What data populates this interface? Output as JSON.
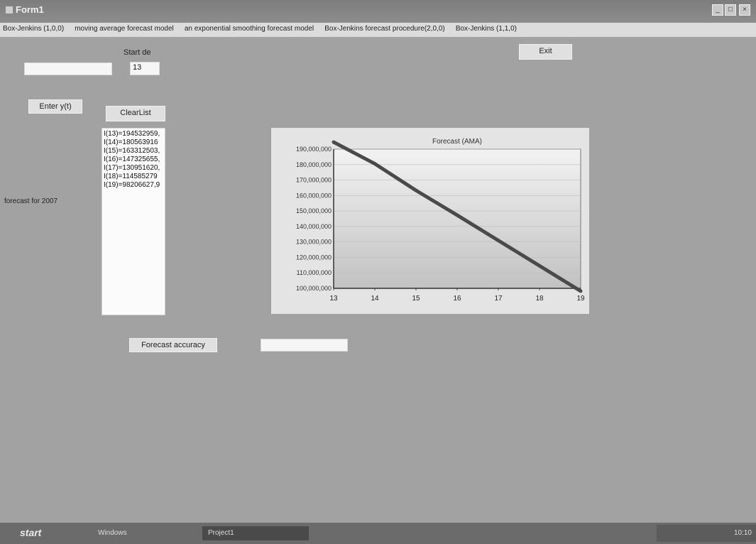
{
  "window": {
    "title": "Form1",
    "minimize_label": "_",
    "maximize_label": "□",
    "close_label": "×"
  },
  "menu": {
    "items": [
      "Box-Jenkins (1,0,0)",
      "moving average forecast model",
      "an exponential smoothing forecast model",
      "Box-Jenkins forecast procedure(2,0,0)",
      "Box-Jenkins (1,1,0)"
    ]
  },
  "form": {
    "input_value": "",
    "start_label": "Start de",
    "start_value": "13",
    "enter_button": "Enter y(t)",
    "clear_button": "ClearList",
    "exit_button": "Exit",
    "forecast_label": "forecast for 2007",
    "accuracy_button": "Forecast accuracy",
    "accuracy_value": ""
  },
  "list": {
    "items": [
      "I(13)=194532959,",
      "I(14)=180563916",
      "I(15)=163312503,",
      "I(16)=147325655,",
      "I(17)=130951620,",
      "I(18)=114585279",
      "I(19)=98206627,9"
    ]
  },
  "chart_data": {
    "type": "line",
    "title": "Forecast (AMA)",
    "x": [
      13,
      14,
      15,
      16,
      17,
      18,
      19
    ],
    "series": [
      {
        "values": [
          194532959,
          180563916,
          163312503,
          147325655,
          130951620,
          114585279,
          98206627.9
        ]
      }
    ],
    "xlim": [
      13,
      19
    ],
    "ylim": [
      100000000,
      190000000
    ],
    "yticks": [
      100000000,
      110000000,
      120000000,
      130000000,
      140000000,
      150000000,
      160000000,
      170000000,
      180000000,
      190000000
    ],
    "ytick_labels": [
      "100,000,000",
      "110,000,000",
      "120,000,000",
      "130,000,000",
      "140,000,000",
      "150,000,000",
      "160,000,000",
      "170,000,000",
      "180,000,000",
      "190,000,000"
    ],
    "xtick_labels": [
      "13",
      "14",
      "15",
      "16",
      "17",
      "18",
      "19"
    ],
    "grid": true,
    "line_color": "#4a4a4a"
  },
  "taskbar": {
    "start_label": "start",
    "tasks": [
      "Windows",
      "Project1"
    ],
    "clock": "10:10"
  }
}
